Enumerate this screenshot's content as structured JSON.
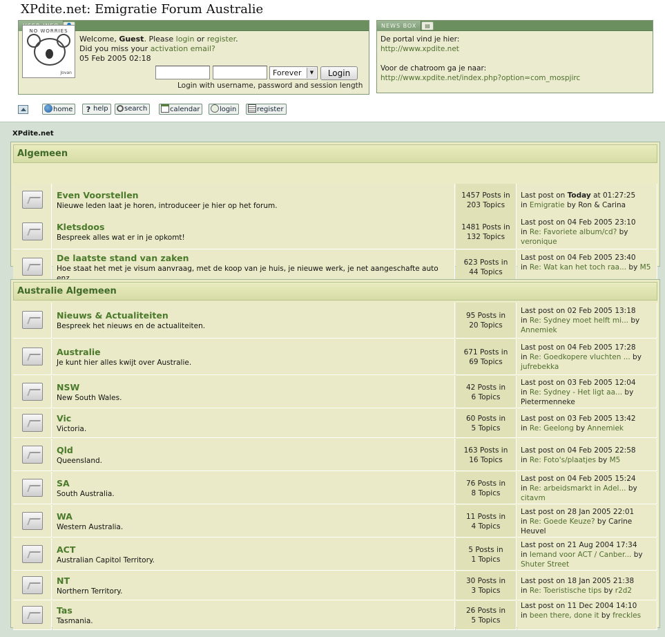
{
  "site": {
    "title": "XPdite.net: Emigratie Forum Australie"
  },
  "user_info": {
    "tab_label": "USER INFO",
    "avatar_caption": "NO WORRIES",
    "avatar_signature": "Jovan",
    "welcome_prefix": "Welcome, ",
    "guest": "Guest",
    "please": ". Please ",
    "login_link": "login",
    "or": " or ",
    "register_link": "register",
    "period": ".",
    "activation_prefix": "Did you miss your ",
    "activation_link": "activation email?",
    "date": "05 Feb 2005 02:18",
    "session_value": "Forever",
    "login_button": "Login",
    "login_hint": "Login with username, password and session length"
  },
  "news_box": {
    "tab_label": "NEWS BOX",
    "line1": "De portal vind je hier:",
    "link1": "http://www.xpdite.net",
    "line2": "Voor de chatroom ga je naar:",
    "link2": "http://www.xpdite.net/index.php?option=com_mospjirc"
  },
  "nav": {
    "home": "home",
    "help": "help",
    "search": "search",
    "calendar": "calendar",
    "login": "login",
    "register": "register"
  },
  "breadcrumb": "XPdite.net",
  "categories": [
    {
      "name": "Algemeen",
      "forums": [
        {
          "title": "Even Voorstellen",
          "desc": "Nieuwe leden laat je horen, introduceer je hier op het forum.",
          "posts": "1457 Posts in",
          "topics": "203 Topics",
          "last_prefix": "Last post on ",
          "last_bold": "Today",
          "last_date": " at 01:27:25",
          "in": "in ",
          "topic": "Emigratie",
          "by": " by ",
          "author": "Ron & Carina"
        },
        {
          "title": "Kletsdoos",
          "desc": "Bespreek alles wat er in je opkomt!",
          "posts": "1481 Posts in",
          "topics": "132 Topics",
          "last_prefix": "Last post on ",
          "last_bold": "",
          "last_date": "04 Feb 2005 23:10",
          "in": "in ",
          "topic": "Re: Favoriete album/cd?",
          "by": " by ",
          "author": "veronique"
        },
        {
          "title": "De laatste stand van zaken",
          "desc": "Hoe staat het met je visum aanvraag, met de koop van je huis, je nieuwe werk, je net aangeschafte auto enz.",
          "posts": "623 Posts in",
          "topics": "44 Topics",
          "last_prefix": "Last post on ",
          "last_bold": "",
          "last_date": "04 Feb 2005 23:40",
          "in": "in ",
          "topic": "Re: Wat kan het toch raa...",
          "by": " by ",
          "author": "M5"
        }
      ]
    },
    {
      "name": "Australie Algemeen",
      "forums": [
        {
          "title": "Nieuws & Actualiteiten",
          "desc": "Bespreek het nieuws en de actualiteiten.",
          "posts": "95 Posts in",
          "topics": "20 Topics",
          "last_prefix": "Last post on ",
          "last_bold": "",
          "last_date": "02 Feb 2005 13:18",
          "in": "in ",
          "topic": "Re: Sydney moet helft mi...",
          "by": " by ",
          "author": "Annemiek"
        },
        {
          "title": "Australie",
          "desc": "Je kunt hier alles kwijt over Australie.",
          "posts": "671 Posts in",
          "topics": "69 Topics",
          "last_prefix": "Last post on ",
          "last_bold": "",
          "last_date": "04 Feb 2005 17:28",
          "in": "in ",
          "topic": "Re: Goedkopere vluchten ...",
          "by": " by ",
          "author": "jufrebekka"
        },
        {
          "title": "NSW",
          "desc": "New South Wales.",
          "posts": "42 Posts in",
          "topics": "6 Topics",
          "last_prefix": "Last post on ",
          "last_bold": "",
          "last_date": "03 Feb 2005 12:04",
          "in": "in ",
          "topic": "Re: Sydney - Het ligt aa...",
          "by": " by ",
          "author": "Pietermenneke"
        },
        {
          "title": "Vic",
          "desc": "Victoria.",
          "posts": "60 Posts in",
          "topics": "5 Topics",
          "last_prefix": "Last post on ",
          "last_bold": "",
          "last_date": "03 Feb 2005 13:42",
          "in": "in ",
          "topic": "Re: Geelong",
          "by": " by ",
          "author": "Annemiek"
        },
        {
          "title": "Qld",
          "desc": "Queensland.",
          "posts": "163 Posts in",
          "topics": "16 Topics",
          "last_prefix": "Last post on ",
          "last_bold": "",
          "last_date": "04 Feb 2005 22:58",
          "in": "in ",
          "topic": "Re: Foto's/plaatjes",
          "by": " by ",
          "author": "M5"
        },
        {
          "title": "SA",
          "desc": "South Australia.",
          "posts": "76 Posts in",
          "topics": "8 Topics",
          "last_prefix": "Last post on ",
          "last_bold": "",
          "last_date": "04 Feb 2005 15:24",
          "in": "in ",
          "topic": "Re: arbeidsmarkt in Adel...",
          "by": " by ",
          "author": "citavm"
        },
        {
          "title": "WA",
          "desc": "Western Australia.",
          "posts": "11 Posts in",
          "topics": "4 Topics",
          "last_prefix": "Last post on ",
          "last_bold": "",
          "last_date": "28 Jan 2005 22:01",
          "in": "in ",
          "topic": "Re: Goede Keuze?",
          "by": " by ",
          "author": "Carine Heuvel"
        },
        {
          "title": "ACT",
          "desc": "Australian Capitol Territory.",
          "posts": "5 Posts in",
          "topics": "1 Topics",
          "last_prefix": "Last post on ",
          "last_bold": "",
          "last_date": "21 Aug 2004 17:34",
          "in": "in ",
          "topic": "Iemand voor ACT / Canber...",
          "by": " by ",
          "author": "Shuter Street"
        },
        {
          "title": "NT",
          "desc": "Northern Territory.",
          "posts": "30 Posts in",
          "topics": "3 Topics",
          "last_prefix": "Last post on ",
          "last_bold": "",
          "last_date": "18 Jan 2005 21:38",
          "in": "in ",
          "topic": "Re: Toeristische tips",
          "by": " by ",
          "author": "r2d2"
        },
        {
          "title": "Tas",
          "desc": "Tasmania.",
          "posts": "26 Posts in",
          "topics": "5 Topics",
          "last_prefix": "Last post on ",
          "last_bold": "",
          "last_date": "11 Dec 2004 14:10",
          "in": "in ",
          "topic": "been there, done it",
          "by": " by ",
          "author": "freckles"
        }
      ]
    }
  ]
}
